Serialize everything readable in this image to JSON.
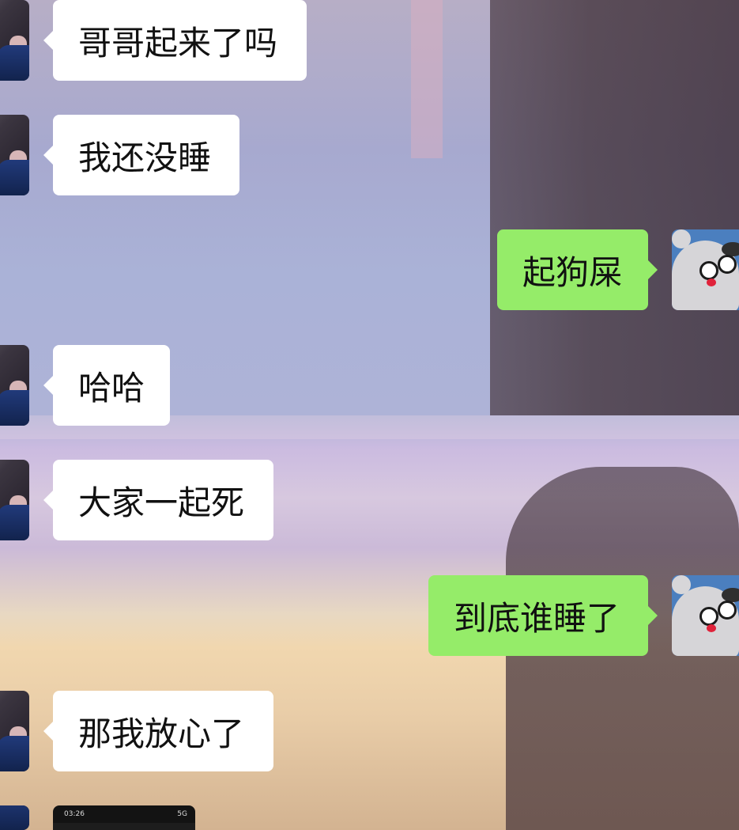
{
  "messages": [
    {
      "side": "left",
      "text": "哥哥起来了吗"
    },
    {
      "side": "left",
      "text": "我还没睡"
    },
    {
      "side": "right",
      "text": "起狗屎"
    },
    {
      "side": "left",
      "text": "哈哈"
    },
    {
      "side": "left",
      "text": "大家一起死"
    },
    {
      "side": "right",
      "text": "到底谁睡了"
    },
    {
      "side": "left",
      "text": "那我放心了"
    }
  ],
  "image_message": {
    "time": "03:26",
    "status": "5G"
  },
  "colors": {
    "incoming_bubble": "#ffffff",
    "outgoing_bubble": "#95ec69",
    "text": "#111111"
  }
}
